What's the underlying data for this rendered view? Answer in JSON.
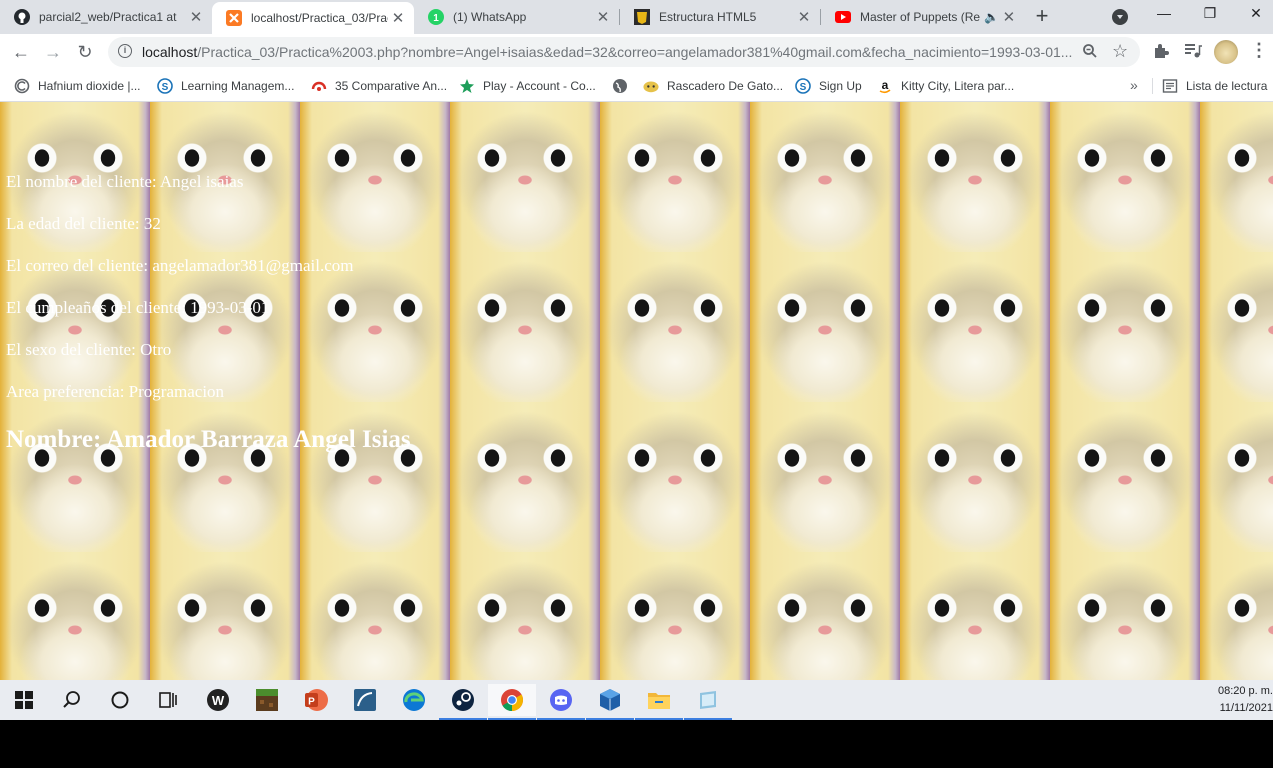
{
  "tabs": [
    {
      "title": "parcial2_web/Practica1 at",
      "icon": "github-icon"
    },
    {
      "title": "localhost/Practica_03/Prac",
      "icon": "xampp-icon",
      "active": true
    },
    {
      "title": "(1) WhatsApp",
      "icon": "whatsapp-icon"
    },
    {
      "title": "Estructura HTML5",
      "icon": "html5-icon"
    },
    {
      "title": "Master of Puppets (Re",
      "icon": "youtube-icon",
      "audio": true
    }
  ],
  "window_controls": {
    "minimize": "—",
    "maximize": "❐",
    "close": "✕"
  },
  "address_bar": {
    "host": "localhost",
    "path": "/Practica_03/Practica%2003.php?nombre=Angel+isaias&edad=32&correo=angelamador381%40gmail.com&fecha_nacimiento=1993-03-01..."
  },
  "bookmarks": [
    {
      "label": "Hafnium dioxide |...",
      "icon": "chrome-page-icon"
    },
    {
      "label": "Learning Managem...",
      "icon": "s-logo-icon"
    },
    {
      "label": "35 Comparative An...",
      "icon": "rays-icon"
    },
    {
      "label": "Play - Account - Co...",
      "icon": "star-icon"
    },
    {
      "label": "",
      "icon": "globe-icon"
    },
    {
      "label": "Rascadero De Gato...",
      "icon": "cat-face-icon"
    },
    {
      "label": "Sign Up",
      "icon": "s-logo-icon"
    },
    {
      "label": "Kitty City, Litera par...",
      "icon": "amazon-icon"
    }
  ],
  "bookmarks_more": "»",
  "reading_list": "Lista de lectura",
  "page": {
    "lines": [
      "El nombre del cliente: Angel isaias",
      "La edad del cliente: 32",
      "El correo del cliente: angelamador381@gmail.com",
      "El cumpleaños del cliente: 1993-03-01",
      "El sexo del cliente: Otro",
      "Area preferencia: Programacion"
    ],
    "heading": "Nombre: Amador Barraza Angel Isias"
  },
  "taskbar": {
    "apps": [
      "windows-start-icon",
      "search-icon",
      "cortana-icon",
      "task-view-icon",
      "wamp-icon",
      "minecraft-icon",
      "powerpoint-icon",
      "mysql-workbench-icon",
      "edge-icon",
      "steam-icon",
      "chrome-icon",
      "discord-icon",
      "virtualbox-icon",
      "file-explorer-icon",
      "tablet-app-icon"
    ],
    "time": "08:20 p. m.",
    "date": "11/11/2021"
  }
}
